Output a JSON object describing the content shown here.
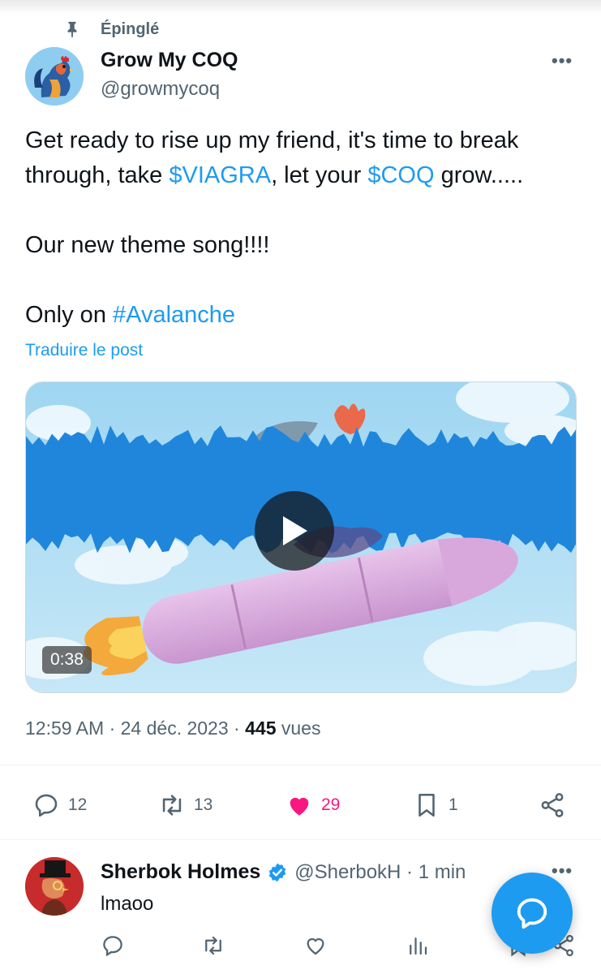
{
  "pinned": {
    "label": "Épinglé",
    "icon": "pin-icon"
  },
  "author": {
    "name": "Grow My COQ",
    "handle": "@growmycoq",
    "avatar": "rooster-avatar"
  },
  "tweet": {
    "line1": "Get ready to rise up my friend, it's time to break",
    "line2_a": "through, take ",
    "line2_cashtag1": "$VIAGRA",
    "line2_b": ", let your ",
    "line2_cashtag2": "$COQ",
    "line2_c": " grow.....",
    "line3": "Our new theme song!!!!",
    "line4_a": "Only on ",
    "line4_hashtag": "#Avalanche",
    "translate_label": "Traduire le post"
  },
  "media": {
    "duration": "0:38",
    "play_icon": "play-icon"
  },
  "meta": {
    "time": "12:59 AM",
    "separator": " · ",
    "date": "24 déc. 2023",
    "views_count": "445",
    "views_label": "vues"
  },
  "actions": {
    "replies": "12",
    "reposts": "13",
    "likes": "29",
    "bookmarks": "1"
  },
  "colors": {
    "accent": "#1d9bf0",
    "like": "#f91880",
    "muted": "#536471",
    "text": "#0f1419"
  },
  "reply": {
    "name": "Sherbok Holmes",
    "handle": "@SherbokH · 1 min",
    "text": "lmaoo",
    "avatar": "rooster-tophat-avatar"
  }
}
